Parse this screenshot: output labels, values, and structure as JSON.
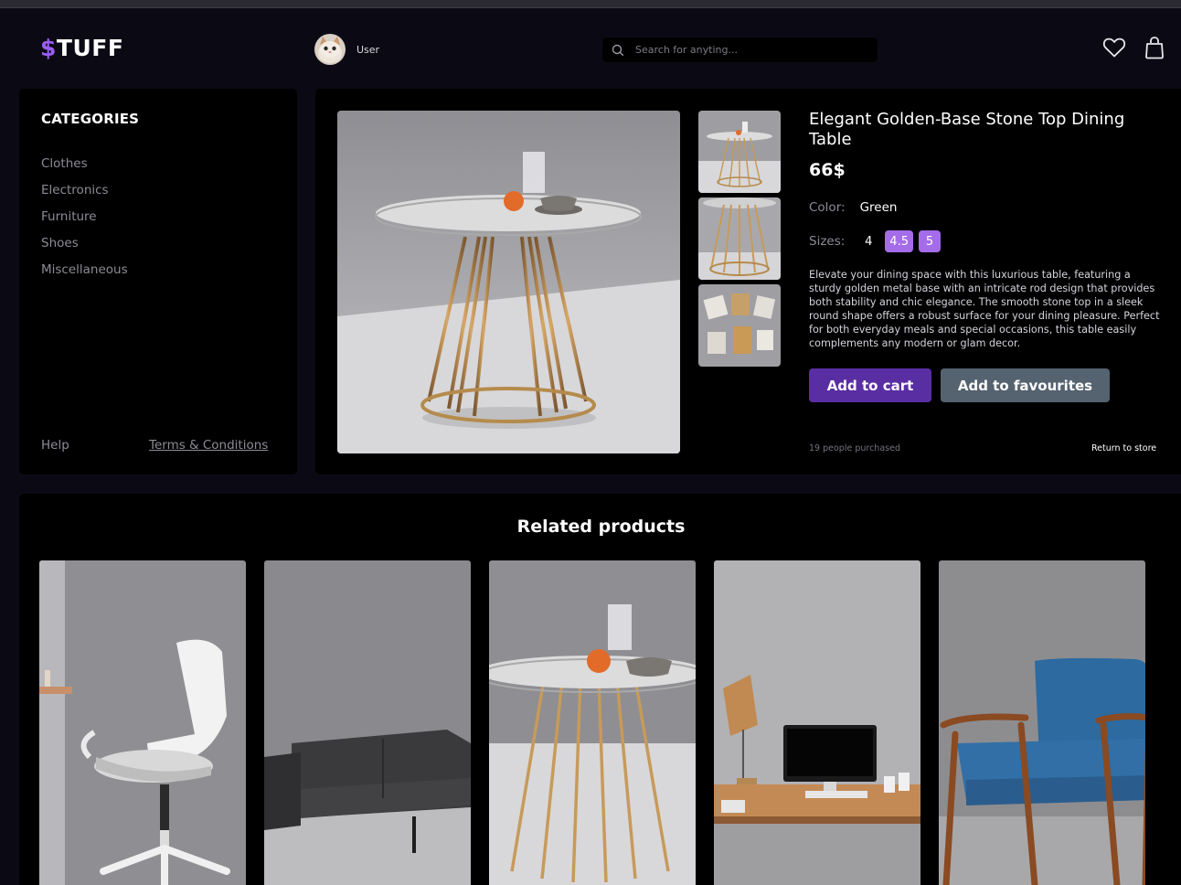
{
  "header": {
    "logo_symbol": "$",
    "logo_text": "TUFF",
    "user_name": "User",
    "search_placeholder": "Search for anyting..."
  },
  "sidebar": {
    "title": "CATEGORIES",
    "categories": [
      "Clothes",
      "Electronics",
      "Furniture",
      "Shoes",
      "Miscellaneous"
    ],
    "help": "Help",
    "terms": "Terms & Conditions"
  },
  "product": {
    "title": "Elegant Golden-Base Stone Top Dining Table",
    "price": "66$",
    "color_label": "Color:",
    "color_value": "Green",
    "sizes_label": "Sizes:",
    "sizes": [
      "4",
      "4.5",
      "5"
    ],
    "description": "Elevate your dining space with this luxurious table, featuring a sturdy golden metal base with an intricate rod design that provides both stability and chic elegance. The smooth stone top in a sleek round shape offers a robust surface for your dining pleasure. Perfect for both everyday meals and special occasions, this table easily complements any modern or glam decor.",
    "add_to_cart": "Add to cart",
    "add_to_favourites": "Add to favourites",
    "purchased": "19 people purchased",
    "return": "Return to store"
  },
  "related": {
    "title": "Related products"
  },
  "colors": {
    "accent": "#9a5df0",
    "cart_button": "#5a2ea3",
    "fav_button": "#556270",
    "size_active": "#a46ce8",
    "panel": "#000000",
    "page_bg": "#0b0a14"
  }
}
